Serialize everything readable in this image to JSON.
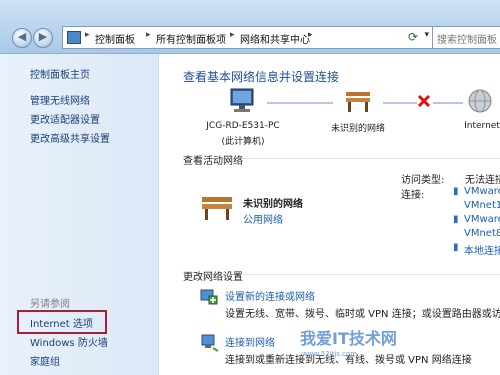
{
  "breadcrumb": [
    "控制面板",
    "所有控制面板项",
    "网络和共享中心"
  ],
  "search_placeholder": "搜索控制面板",
  "sidebar": {
    "home": "控制面板主页",
    "links": [
      "管理无线网络",
      "更改适配器设置",
      "更改高级共享设置"
    ],
    "see_also_title": "另请参阅",
    "see_also": [
      "Internet 选项",
      "Windows 防火墙",
      "家庭组"
    ]
  },
  "main": {
    "title": "查看基本网络信息并设置连接",
    "map": {
      "computer_name": "JCG-RD-E531-PC",
      "computer_sub": "(此计算机)",
      "network": "未识别的网络",
      "internet": "Internet"
    },
    "active_section": "查看活动网络",
    "active_network": {
      "name": "未识别的网络",
      "type": "公用网络",
      "access_label": "访问类型:",
      "access_value": "无法连接",
      "connections_label": "连接:",
      "connections": [
        "VMware",
        "VMnet1",
        "VMware",
        "VMnet8",
        "本地连接"
      ]
    },
    "change_section": "更改网络设置",
    "tasks": [
      {
        "title": "设置新的连接或网络",
        "desc": "设置无线、宽带、拨号、临时或 VPN 连接；或设置路由器或访问点"
      },
      {
        "title": "连接到网络",
        "desc": "连接到或重新连接到无线、有线、拨号或 VPN 网络连接"
      }
    ]
  },
  "watermark": {
    "text": "我爱IT技术网",
    "url": "www.52itjs.com"
  },
  "colors": {
    "link": "#1a5fb4",
    "title": "#1e4f9a",
    "highlight_box": "#a3213a"
  }
}
